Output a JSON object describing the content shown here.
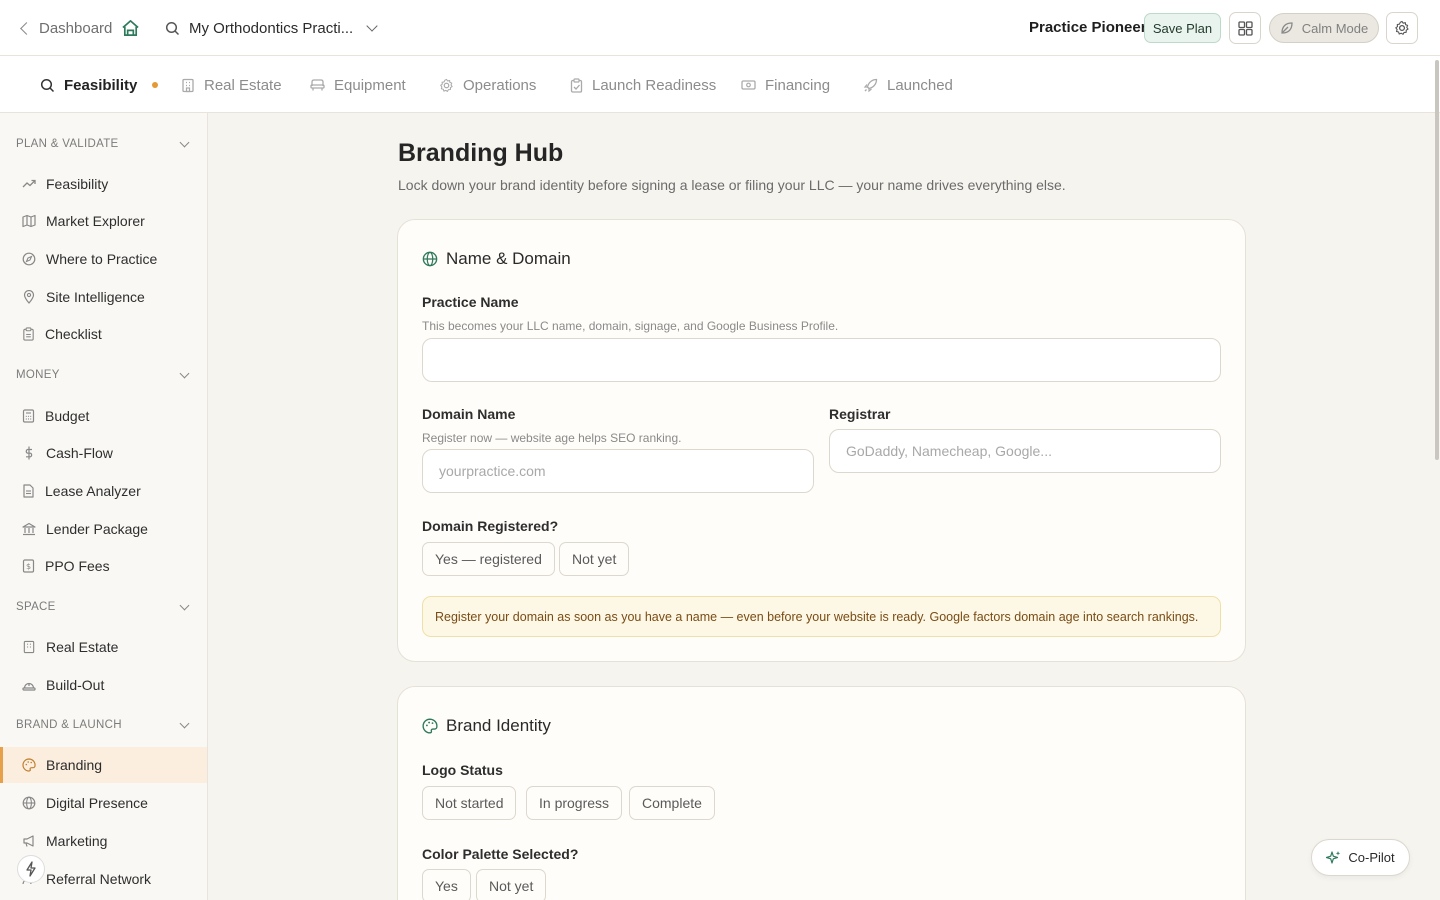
{
  "header": {
    "back_label": "Dashboard",
    "project_name": "My Orthodontics Practi...",
    "user_name": "Practice Pioneer",
    "save_label": "Save Plan",
    "calm_label": "Calm Mode"
  },
  "tabs": [
    {
      "label": "Feasibility",
      "icon": "search-icon",
      "active": true
    },
    {
      "label": "Real Estate",
      "icon": "building-icon"
    },
    {
      "label": "Equipment",
      "icon": "chair-icon"
    },
    {
      "label": "Operations",
      "icon": "gear-icon"
    },
    {
      "label": "Launch Readiness",
      "icon": "clipboard-check-icon"
    },
    {
      "label": "Financing",
      "icon": "banknote-icon"
    },
    {
      "label": "Launched",
      "icon": "rocket-icon"
    }
  ],
  "sidebar": {
    "sections": [
      {
        "title": "PLAN & VALIDATE",
        "items": [
          "Feasibility",
          "Market Explorer",
          "Where to Practice",
          "Site Intelligence",
          "Checklist"
        ]
      },
      {
        "title": "MONEY",
        "items": [
          "Budget",
          "Cash-Flow",
          "Lease Analyzer",
          "Lender Package",
          "PPO Fees"
        ]
      },
      {
        "title": "SPACE",
        "items": [
          "Real Estate",
          "Build-Out"
        ]
      },
      {
        "title": "BRAND & LAUNCH",
        "items": [
          "Branding",
          "Digital Presence",
          "Marketing",
          "Referral Network"
        ]
      }
    ],
    "active_item": "Branding"
  },
  "main": {
    "title": "Branding Hub",
    "subtitle": "Lock down your brand identity before signing a lease or filing your LLC — your name drives everything else.",
    "name_domain": {
      "title": "Name & Domain",
      "practice_name_label": "Practice Name",
      "practice_name_hint": "This becomes your LLC name, domain, signage, and Google Business Profile.",
      "practice_name_value": "",
      "domain_label": "Domain Name",
      "domain_hint": "Register now — website age helps SEO ranking.",
      "domain_placeholder": "yourpractice.com",
      "registrar_label": "Registrar",
      "registrar_placeholder": "GoDaddy, Namecheap, Google...",
      "registered_label": "Domain Registered?",
      "registered_options": [
        "Yes — registered",
        "Not yet"
      ],
      "note": "Register your domain as soon as you have a name — even before your website is ready. Google factors domain age into search rankings."
    },
    "brand_identity": {
      "title": "Brand Identity",
      "logo_label": "Logo Status",
      "logo_options": [
        "Not started",
        "In progress",
        "Complete"
      ],
      "palette_label": "Color Palette Selected?",
      "palette_options": [
        "Yes",
        "Not yet"
      ]
    }
  },
  "copilot_label": "Co-Pilot",
  "colors": {
    "accent": "#e6a04a",
    "green": "#2f7a5c",
    "active_bg": "#fbeede"
  }
}
